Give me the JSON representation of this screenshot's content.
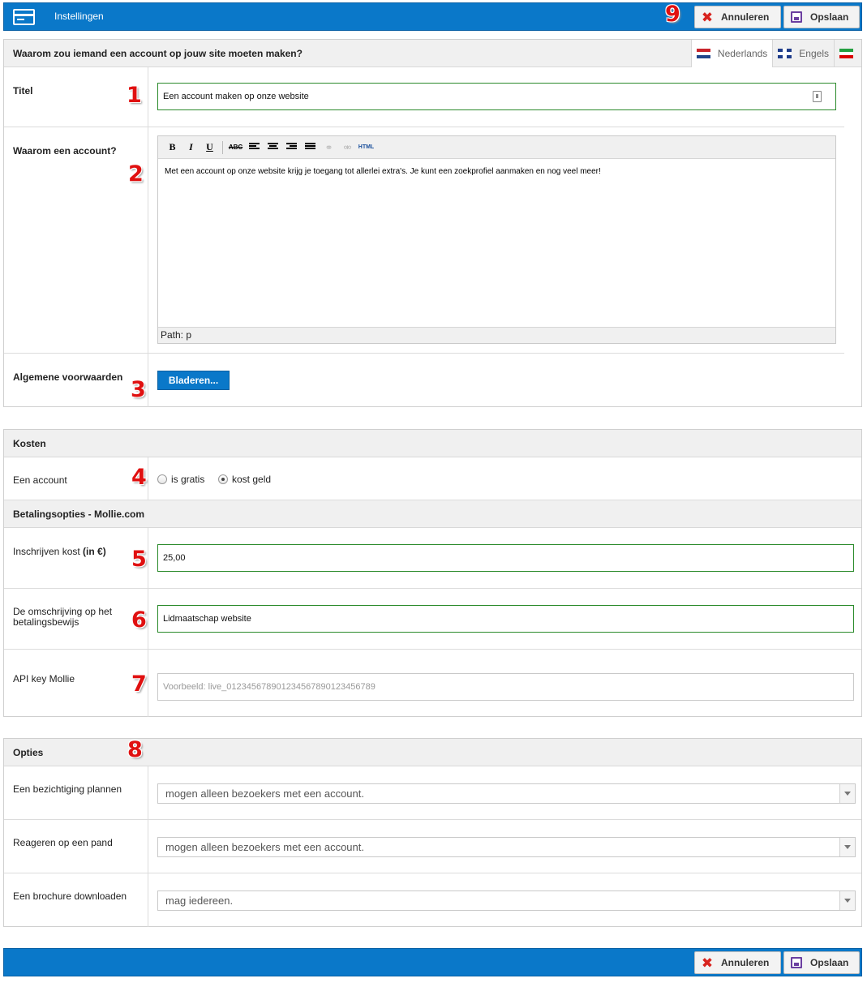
{
  "header": {
    "title": "Instellingen",
    "cancel_label": "Annuleren",
    "save_label": "Opslaan"
  },
  "account_section": {
    "heading": "Waarom zou iemand een account op jouw site moeten maken?",
    "languages": [
      "Nederlands",
      "Engels",
      ""
    ],
    "title_label": "Titel",
    "title_value": "Een account maken op onze website",
    "why_label": "Waarom een account?",
    "editor_text": "Met een account op onze website krijg je toegang tot allerlei extra's. Je kunt een zoekprofiel aanmaken en nog veel meer!",
    "editor_path": "Path: p",
    "terms_label": "Algemene voorwaarden",
    "browse_label": "Bladeren..."
  },
  "costs_section": {
    "heading": "Kosten",
    "account_label": "Een account",
    "option_free": "is gratis",
    "option_paid": "kost geld",
    "selected": "kost geld",
    "payment_heading": "Betalingsopties - Mollie.com",
    "fee_label": "Inschrijven kost",
    "fee_unit": "(in €)",
    "fee_value": "25,00",
    "description_label": "De omschrijving op het betalingsbewijs",
    "description_value": "Lidmaatschap website",
    "api_label": "API key Mollie",
    "api_placeholder": "Voorbeeld: live_012345678901234567890123456789"
  },
  "options_section": {
    "heading": "Opties",
    "rows": [
      {
        "label": "Een bezichtiging plannen",
        "value": "mogen alleen bezoekers met een account."
      },
      {
        "label": "Reageren op een pand",
        "value": "mogen alleen bezoekers met een account."
      },
      {
        "label": "Een brochure downloaden",
        "value": "mag iedereen."
      }
    ]
  },
  "annotations": [
    "1",
    "2",
    "3",
    "4",
    "5",
    "6",
    "7",
    "8",
    "9"
  ],
  "colors": {
    "accent": "#0a78c9",
    "input_border": "#2a8a2a",
    "annotation": "#e01010"
  }
}
